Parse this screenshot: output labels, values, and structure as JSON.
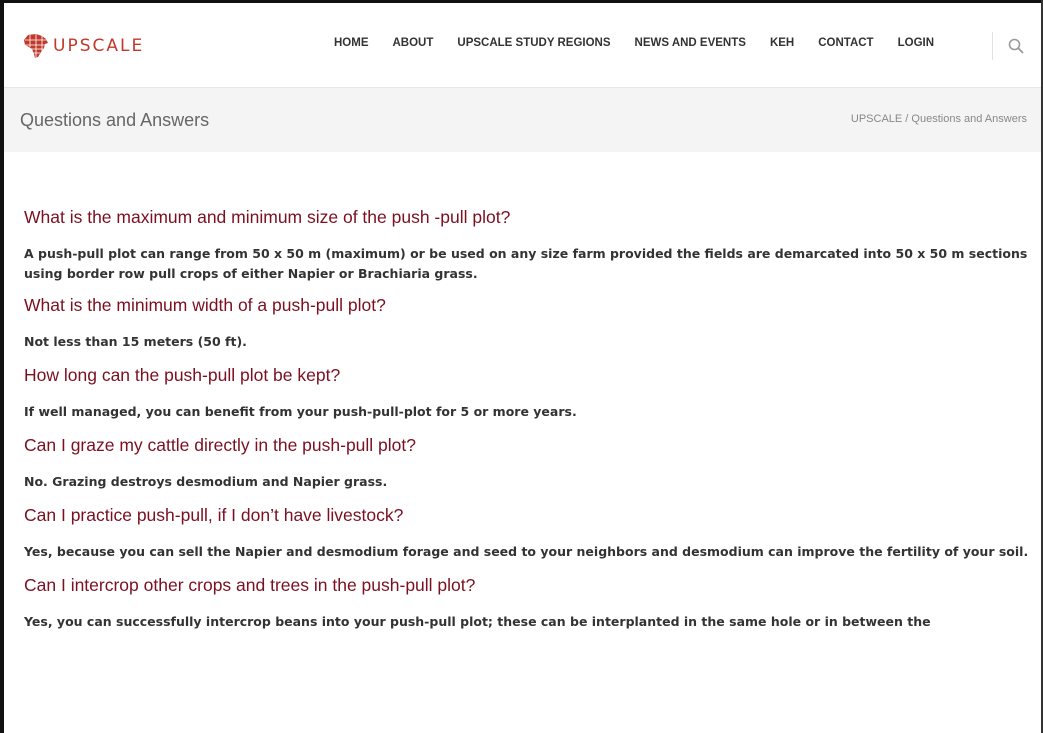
{
  "brand": {
    "name": "UPSCALE",
    "color": "#c0392b",
    "icon": "africa-map-logo-icon"
  },
  "nav": {
    "items": [
      "HOME",
      "ABOUT",
      "UPSCALE STUDY REGIONS",
      "NEWS AND EVENTS",
      "KEH",
      "CONTACT",
      "LOGIN"
    ],
    "search_icon": "search-icon"
  },
  "title_bar": {
    "title": "Questions and Answers",
    "breadcrumb": {
      "home": "UPSCALE",
      "separator": " / ",
      "current": "Questions and Answers"
    }
  },
  "colors": {
    "question": "#7b1020",
    "answer": "#333333",
    "title_bar_bg": "#f4f4f4"
  },
  "qa": [
    {
      "question": "What is the maximum and minimum size of the push -pull plot?",
      "answer": "A push-pull plot can range from 50 x 50 m (maximum) or be used on any size farm provided the fields are demarcated into 50 x 50 m sections using border row pull crops of either Napier or Brachiaria grass."
    },
    {
      "question": "What is the minimum width of a push-pull plot?",
      "answer": "Not less than 15 meters (50 ft)."
    },
    {
      "question": "How long can the push-pull plot be kept?",
      "answer": "If well managed, you can benefit from your push-pull-plot for 5 or more years."
    },
    {
      "question": "Can I graze my cattle directly in the push-pull plot?",
      "answer": "No. Grazing destroys desmodium and Napier grass."
    },
    {
      "question": "Can I practice push-pull, if I don’t have livestock?",
      "answer": "Yes, because you can sell the Napier and desmodium forage and seed to your neighbors and desmodium can improve the fertility of your soil."
    },
    {
      "question": "Can I intercrop other crops and trees in the push-pull plot?",
      "answer": "Yes, you can successfully intercrop beans into your push-pull plot; these can be interplanted in the same hole or in between the"
    }
  ]
}
